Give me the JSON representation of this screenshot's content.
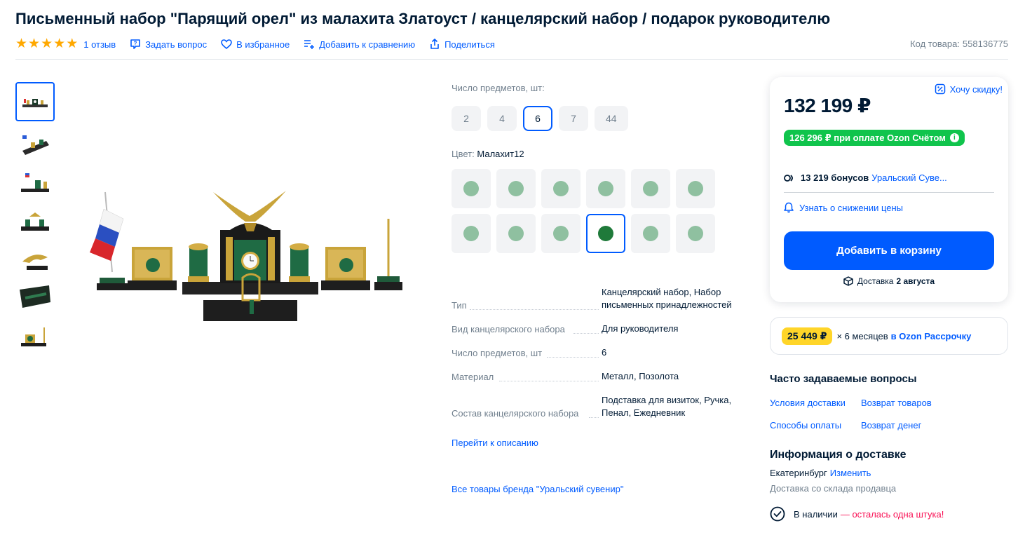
{
  "product": {
    "title": "Письменный набор \"Парящий орел\" из малахита Златоуст / канцелярский набор / подарок руководителю",
    "rating_stars": 5,
    "reviews": "1 отзыв",
    "ask": "Задать вопрос",
    "favorite": "В избранное",
    "compare": "Добавить к сравнению",
    "share": "Поделиться",
    "sku_label": "Код товара:",
    "sku": "558136775"
  },
  "options": {
    "count_label": "Число предметов, шт:",
    "counts": [
      "2",
      "4",
      "6",
      "7",
      "44"
    ],
    "count_selected": "6",
    "color_label": "Цвет:",
    "color_value": "Малахит12",
    "colors_total": 12,
    "color_selected_index": 9,
    "colors": {
      "swatch": "#8fc0a0",
      "swatch_selected": "#1f7a3a"
    }
  },
  "characteristics": [
    {
      "key": "Тип",
      "value": "Канцелярский набор, Набор письменных принадлежностей"
    },
    {
      "key": "Вид канцелярского набора",
      "value": "Для руководителя"
    },
    {
      "key": "Число предметов, шт",
      "value": "6"
    },
    {
      "key": "Материал",
      "value": "Металл, Позолота"
    },
    {
      "key": "Состав канцелярского набора",
      "value": "Подставка для визиток, Ручка, Пенал, Ежедневник"
    }
  ],
  "links": {
    "to_description": "Перейти к описанию",
    "brand_all": "Все товары бренда \"Уральский сувенир\""
  },
  "price_card": {
    "want_discount": "Хочу скидку!",
    "price": "132 199 ₽",
    "ozon_price": "126 296 ₽ при оплате Ozon Счётом",
    "bonus_amount": "13 219 бонусов",
    "seller": "Уральский Суве...",
    "notify": "Узнать о снижении цены",
    "add_to_cart": "Добавить в корзину",
    "delivery_label": "Доставка",
    "delivery_date": "2 августа",
    "colors": {
      "accent": "#005bff",
      "green": "#10c44c"
    }
  },
  "installment": {
    "amount": "25 449 ₽",
    "months": "× 6 месяцев",
    "link": "в Ozon Рассрочку"
  },
  "faq": {
    "title": "Часто задаваемые вопросы",
    "items": [
      "Условия доставки",
      "Возврат товаров",
      "Способы оплаты",
      "Возврат денег"
    ]
  },
  "delivery_info": {
    "title": "Информация о доставке",
    "city": "Екатеринбург",
    "change": "Изменить",
    "warehouse": "Доставка со склада продавца",
    "stock": "В наличии",
    "stock_warning": "— осталась одна штука!"
  }
}
